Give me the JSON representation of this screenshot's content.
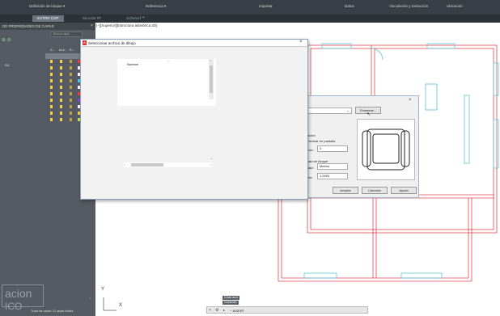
{
  "ribbon": {
    "items": [
      "Definición de bloque ▾",
      "Referencia ▾",
      "Importar",
      "Datos",
      "Vinculación y extracción",
      "Ubicación"
    ]
  },
  "tabs": [
    "EXTRO COP",
    "SILLON TP",
    "CONAUT"
  ],
  "palette": {
    "title": "DE PROPIEDADES DE CAPAS",
    "search_placeholder": "Buscar capa",
    "col_headers": [
      "A...",
      "Inut...",
      "B..."
    ],
    "left_label": "RA",
    "bottom_status": "Todas las capas: 21 capas totales",
    "watermark": [
      "acion",
      "ICO"
    ]
  },
  "viewport": {
    "label": "[−][Superior][Estructura alámbrica 2D]",
    "ucs": {
      "y": "Y",
      "x": "X"
    }
  },
  "insert_dialog": {
    "browse_label": "Examinar...",
    "section_insertion": "tación",
    "specify_on_screen": "Precisar en pantalla",
    "angle_label": "gulo:",
    "angle_value": "0",
    "block_unit_label": "idad de bloque",
    "unit_label": "idad:",
    "unit_value": "Metros",
    "factor_label": "ctor:",
    "factor_value": "1.0000",
    "buttons": [
      "Aceptar",
      "Cancelar",
      "Ayuda"
    ]
  },
  "file_dialog": {
    "title": "Seleccionar archivo de dibujo",
    "column_name": "Nombre"
  },
  "command": {
    "chips": [
      "Cotas acot",
      "Comando:"
    ],
    "input": "− INSERT"
  },
  "colors": {
    "ribbon": "#3a3f47",
    "palette": "#565b63",
    "walls": "#e0474f",
    "cyan_lines": "#59c8d8"
  }
}
